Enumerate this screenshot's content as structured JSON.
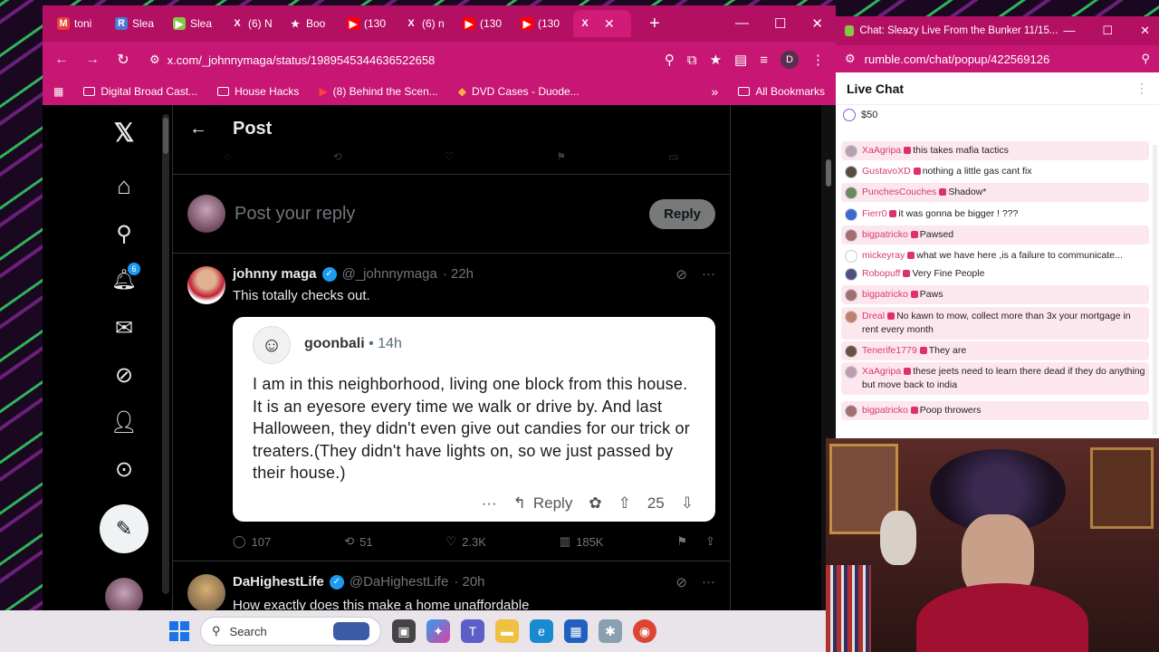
{
  "browser": {
    "tabs": [
      {
        "icon": "gmail-icon",
        "label": "toni",
        "color": "#ea4335",
        "glyph": "M"
      },
      {
        "icon": "rumble-r-icon",
        "label": "Slea",
        "color": "#4a7bd4",
        "glyph": "R"
      },
      {
        "icon": "rumble-play-icon",
        "label": "Slea",
        "color": "#85c742",
        "glyph": "▶"
      },
      {
        "icon": "x-logo-icon",
        "label": "(6) N",
        "color": "#000000",
        "glyph": "X"
      },
      {
        "icon": "star-icon",
        "label": "Boo",
        "color": "#ffffff",
        "glyph": "★"
      },
      {
        "icon": "youtube-icon",
        "label": "(130",
        "color": "#ff0000",
        "glyph": "▶"
      },
      {
        "icon": "x-logo-icon",
        "label": "(6) n",
        "color": "#000000",
        "glyph": "X"
      },
      {
        "icon": "youtube-icon",
        "label": "(130",
        "color": "#ff0000",
        "glyph": "▶"
      },
      {
        "icon": "youtube-icon",
        "label": "(130",
        "color": "#ff0000",
        "glyph": "▶"
      },
      {
        "icon": "x-logo-icon",
        "label": "",
        "color": "#000000",
        "glyph": "X",
        "active": true
      }
    ],
    "url": "x.com/_johnnymaga/status/1989545344636522658",
    "profile_initial": "D",
    "bookmarks": [
      "Digital Broad Cast...",
      "House Hacks",
      "(8) Behind the Scen...",
      "DVD Cases - Duode..."
    ],
    "all_bookmarks": "All Bookmarks"
  },
  "x": {
    "notification_count": "6",
    "page_title": "Post",
    "reply_placeholder": "Post your reply",
    "reply_button": "Reply",
    "tweet": {
      "name": "johnny maga",
      "handle": "@_johnnymaga",
      "time": "· 22h",
      "text": "This totally checks out.",
      "embed": {
        "user": "goonbali",
        "time": "• 14h",
        "body": "I am in this neighborhood, living one block from this house. It is an eyesore every time we walk or drive by. And last Halloween, they didn't even give out candies for our trick or treaters.(They didn't have lights on, so we just passed by their house.)",
        "reply_label": "Reply",
        "votes": "25"
      },
      "metrics": {
        "replies": "107",
        "reposts": "51",
        "likes": "2.3K",
        "views": "185K"
      }
    },
    "next_tweet": {
      "name": "DaHighestLife",
      "handle": "@DaHighestLife",
      "time": "· 20h",
      "text": "How exactly does this make a home unaffordable"
    }
  },
  "chat": {
    "window_title": "Chat: Sleazy Live From the Bunker 11/15...",
    "url": "rumble.com/chat/popup/422569126",
    "header": "Live Chat",
    "tip_amount": "$50",
    "messages": [
      {
        "user": "XaAgripa",
        "text": "this takes mafia tactics",
        "tint": true,
        "avatar": "#b9a0b0"
      },
      {
        "user": "GustavoXD",
        "text": "nothing a little gas cant fix",
        "tint": false,
        "avatar": "#5a4a40"
      },
      {
        "user": "PunchesCouches",
        "text": "Shadow*",
        "tint": true,
        "avatar": "#6a8a60"
      },
      {
        "user": "Fierr0",
        "text": "it was gonna be bigger ! ???",
        "tint": false,
        "avatar": "#3a6ad0"
      },
      {
        "user": "bigpatricko",
        "text": "Pawsed",
        "tint": true,
        "avatar": "#a07070"
      },
      {
        "user": "mickeyray",
        "text": "what we have here ,is a failure to communicate...",
        "tint": false,
        "avatar": "#ffffff"
      },
      {
        "user": "Robopuff",
        "text": "Very Fine People",
        "tint": false,
        "avatar": "#505080"
      },
      {
        "user": "bigpatricko",
        "text": "Paws",
        "tint": true,
        "avatar": "#a07070"
      },
      {
        "user": "Dreal",
        "text": "No kawn to mow, collect more than 3x your mortgage in rent every month",
        "tint": true,
        "avatar": "#c08070"
      },
      {
        "user": "Tenerife1779",
        "text": "They are",
        "tint": true,
        "avatar": "#6a5040"
      },
      {
        "user": "XaAgripa",
        "text": "these jeets need to learn there dead if they do anything but move back to india",
        "tint": true,
        "avatar": "#b9a0b0"
      },
      {
        "user": "bigpatricko",
        "text": "Poop throwers",
        "tint": true,
        "avatar": "#a07070"
      }
    ]
  },
  "taskbar": {
    "search_label": "Search"
  },
  "colors": {
    "accent": "#c71673",
    "x_blue": "#1d9bf0"
  }
}
